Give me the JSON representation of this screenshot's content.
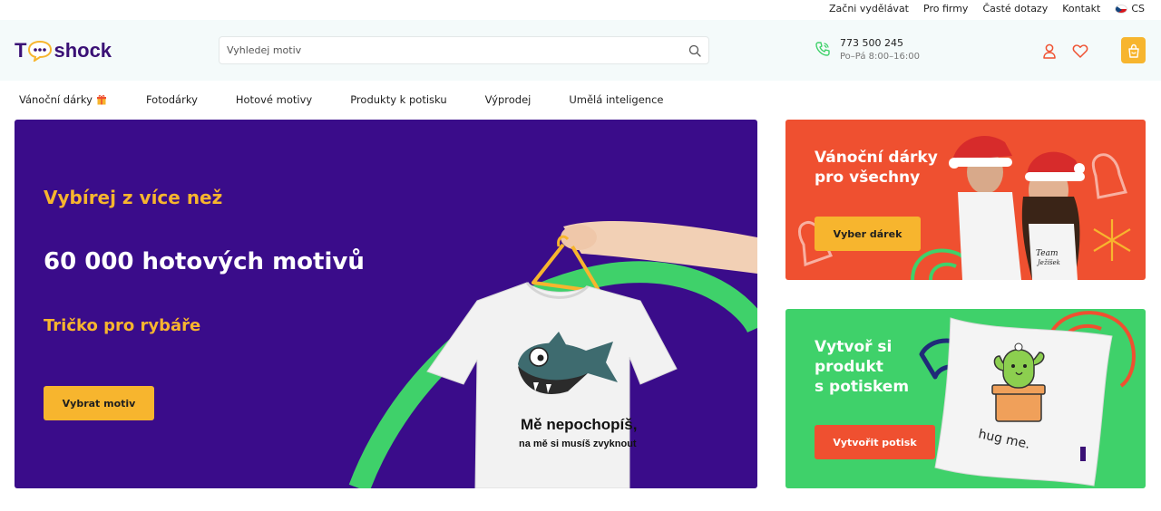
{
  "topbar": {
    "links": [
      "Začni vydělávat",
      "Pro firmy",
      "Časté dotazy",
      "Kontakt"
    ],
    "language": "CS"
  },
  "header": {
    "logo_left": "T",
    "logo_right": "shock",
    "search_placeholder": "Vyhledej motiv",
    "phone": "773 500 245",
    "hours": "Po–Pá 8:00–16:00"
  },
  "nav": {
    "items": [
      "Vánoční dárky",
      "Fotodárky",
      "Hotové motivy",
      "Produkty k potisku",
      "Výprodej",
      "Umělá inteligence"
    ]
  },
  "hero": {
    "pre_title": "Vybírej z více než",
    "title": "60 000 hotových motivů",
    "subtitle": "Tričko pro rybáře",
    "cta": "Vybrat motiv",
    "shirt_line1": "Mě nepochopíš,",
    "shirt_line2": "na mě si musíš zvyknout"
  },
  "promos": {
    "xmas": {
      "title_line1": "Vánoční dárky",
      "title_line2": "pro všechny",
      "button": "Vyber dárek",
      "shirt_text_1": "Team",
      "shirt_text_2": "Ježíšek"
    },
    "print": {
      "title_line1": "Vytvoř si",
      "title_line2": "produkt",
      "title_line3": "s potiskem",
      "button": "Vytvořit potisk",
      "pillow_text": "hug me."
    }
  },
  "colors": {
    "brand_purple": "#3a0c8a",
    "accent_yellow": "#f7b52e",
    "promo_red": "#ef5030",
    "promo_green": "#3fd16a",
    "header_bg": "#f4fafa"
  },
  "icons": [
    "speech-bubble-logo-icon",
    "search-icon",
    "phone-icon",
    "user-icon",
    "heart-icon",
    "shopping-bag-icon",
    "gift-icon",
    "czech-flag-icon"
  ]
}
